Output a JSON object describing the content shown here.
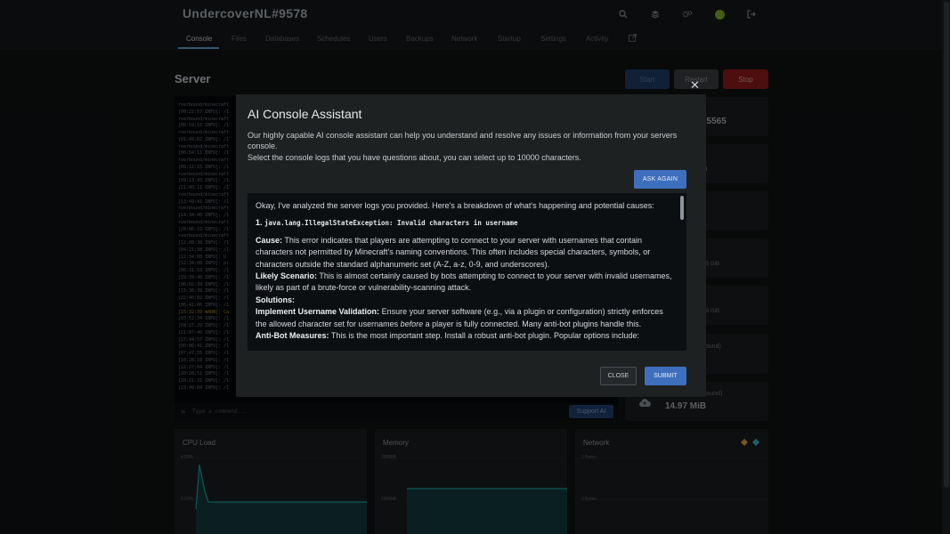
{
  "app": {
    "server_name": "UndercoverNL#9578"
  },
  "nav": {
    "tabs": [
      "Console",
      "Files",
      "Databases",
      "Schedules",
      "Users",
      "Backups",
      "Network",
      "Startup",
      "Settings",
      "Activity"
    ],
    "active": "Console"
  },
  "page": {
    "title": "Server"
  },
  "controls": {
    "start": "Start",
    "restart": "Restart",
    "stop": "Stop"
  },
  "console": {
    "lines": [
      "rverbound/minecraft",
      "[00:22:57 INFO]: /1",
      "rverbound/minecraft",
      "[00:59:15 INFO]: /1",
      "rverbound/minecraft",
      "[01:49:02 INFO]: /1",
      "rverbound/minecraft",
      "[06:54:11 INFO]: /1",
      "rverbound/minecraft",
      "[09:12:15 INFO]: /1",
      "rverbound/minecraft",
      "[09:13:43 INFO]: /1",
      "[11:00:11 INFO]: /1",
      "rverbound/minecraft",
      "[13:49:41 INFO]: /1",
      "rverbound/minecraft",
      "[14:34:40 INFO]: /1",
      "rverbound/minecraft",
      "[20:06:23 INFO]: /1",
      "rverbound/minecraft",
      "[12:08:38 INFO]: /1",
      "[04:21:38 INFO]: /1",
      "[12:34:08 INFO]: U",
      "[12:34:08 INFO]: pr",
      "[06:31:53 INFO]: /1",
      "[19:39:48 INFO]: /1",
      "[06:02:39 INFO]: /1",
      "[15:36:39 INFO]: /1",
      "[22:40:02 INFO]: /1",
      "[06:41:06 INFO]: /1",
      "[15:32:39 WARN]: Ca",
      "[03:52:34 INFO]: /1",
      "[04:27:29 INFO]: /1",
      "[11:07:40 INFO]: /1",
      "[17:44:57 INFO]: /1",
      "[00:06:41 INFO]: /1",
      "[07:47:55 INFO]: /1",
      "[10:28:18 INFO]: /1",
      "[22:27:04 INFO]: /1",
      "[20:28:51 INFO]: /1",
      "[20:21:31 INFO]: /1",
      "[23:49:04 INFO]: /1"
    ],
    "input_placeholder": "Type a command...",
    "support_button": "Support AI"
  },
  "stats": {
    "address_fragment": "25565",
    "uptime_fragment": "n",
    "cpu_limit_fragment": ".95 GiB",
    "memory_fragment": ".88 GiB",
    "net_in_label_fragment": "bound)",
    "net_out_label_fragment": "(Outbound)",
    "net_out_value": "14.97 MiB"
  },
  "graphs": {
    "cpu": {
      "title": "CPU Load",
      "ticks": [
        "4.00%",
        "2.00%"
      ]
    },
    "memory": {
      "title": "Memory",
      "ticks": [
        "200MiB",
        "100MiB"
      ]
    },
    "network": {
      "title": "Network",
      "ticks": [
        "1 Bytes",
        "0 Bytes"
      ]
    }
  },
  "modal": {
    "title": "AI Console Assistant",
    "desc_line1": "Our highly capable AI console assistant can help you understand and resolve any issues or information from your servers console.",
    "desc_line2": "Select the console logs that you have questions about, you can select up to 10000 characters.",
    "ask_again": "ASK AGAIN",
    "response": {
      "intro": "Okay, I've analyzed the server logs you provided. Here's a breakdown of what's happening and potential causes:",
      "item_number": "1.",
      "item_code": "java.lang.IllegalStateException: Invalid characters in username",
      "cause_label": "Cause:",
      "cause_text": "This error indicates that players are attempting to connect to your server with usernames that contain characters not permitted by Minecraft's naming conventions. This often includes special characters, symbols, or characters outside the standard alphanumeric set (A-Z, a-z, 0-9, and underscores).",
      "likely_label": "Likely Scenario:",
      "likely_text": "This is almost certainly caused by bots attempting to connect to your server with invalid usernames, likely as part of a brute-force or vulnerability-scanning attack.",
      "solutions_label": "Solutions:",
      "validation_label": "Implement Username Validation:",
      "validation_text_a": "Ensure your server software (e.g., via a plugin or configuration) strictly enforces the allowed character set for usernames",
      "validation_emph": "before",
      "validation_text_b": "a player is fully connected. Many anti-bot plugins handle this.",
      "antibot_label": "Anti-Bot Measures:",
      "antibot_text": "This is the most important step. Install a robust anti-bot plugin. Popular options include:"
    },
    "close": "CLOSE",
    "submit": "SUBMIT"
  }
}
